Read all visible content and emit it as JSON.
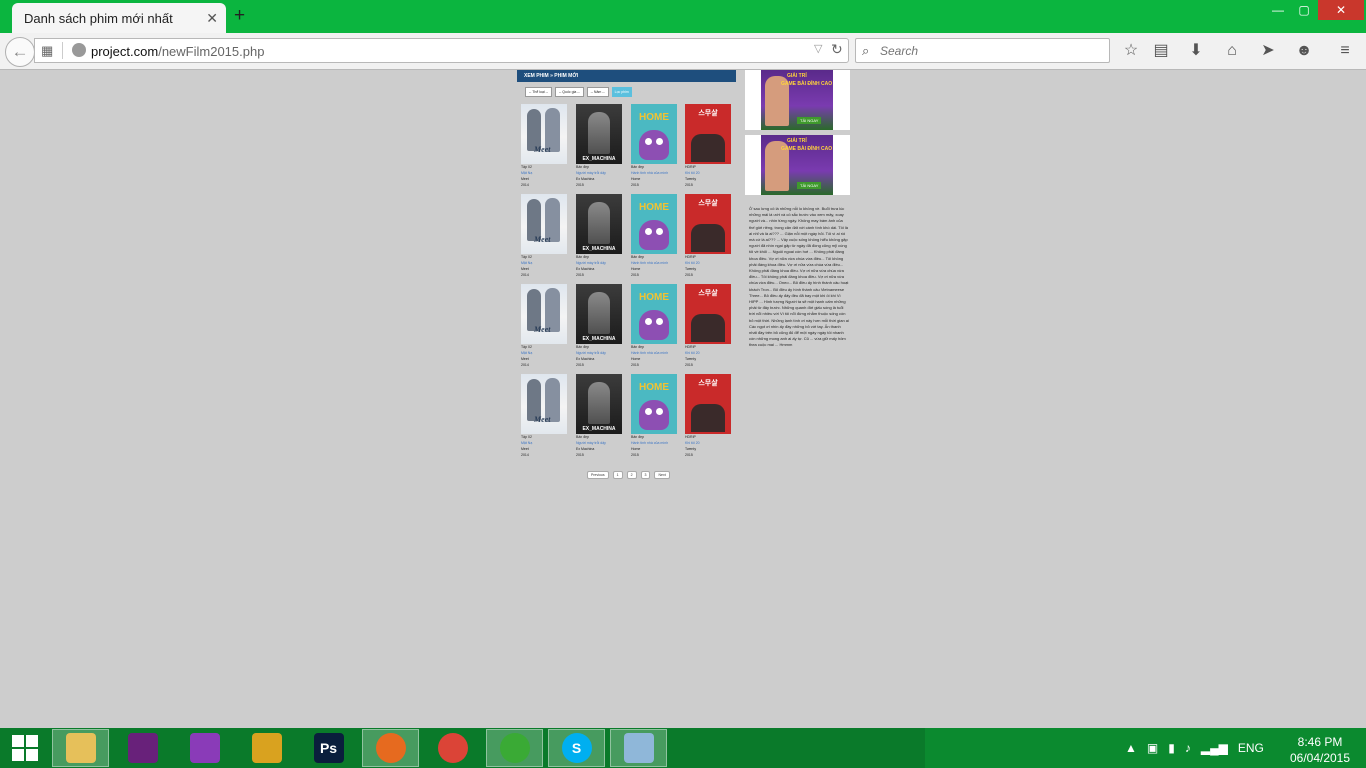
{
  "browser": {
    "tab_title": "Danh sách phim mới nhất",
    "tab_close": "✕",
    "new_tab": "+",
    "url_host": "project.com",
    "url_path": "/newFilm2015.php",
    "search_placeholder": "Search",
    "window_controls": {
      "minimize": "—",
      "maximize": "▢",
      "close": "✕"
    },
    "toolbar_icons": [
      "star-icon",
      "reading-list-icon",
      "download-icon",
      "home-icon",
      "send-icon",
      "smiley-icon",
      "menu-icon"
    ]
  },
  "page": {
    "header": "XEM PHIM » PHIM MỚI",
    "filters": [
      "-- Thể loại --",
      "-- Quốc gia --",
      "-- Năm --"
    ],
    "filter_button": "Lọc phim",
    "films": [
      {
        "poster": "meet",
        "line1": "Tập 02",
        "line2": "Mặt Nạ",
        "line3": "Meet",
        "line4": "2014"
      },
      {
        "poster": "ex",
        "line1": "Bản đẹp",
        "line2": "Người máy trỗi dậy",
        "line3": "Ex Machina",
        "line4": "2015"
      },
      {
        "poster": "home",
        "line1": "Bản đẹp",
        "line2": "Hành tinh nhà của mình",
        "line3": "Home",
        "line4": "2015"
      },
      {
        "poster": "tw",
        "line1": "HDRIP",
        "line2": "Khi tôi 20",
        "line3": "Twenty",
        "line4": "2015"
      }
    ],
    "pagination": [
      "Previous",
      "1",
      "2",
      "3",
      "Next"
    ],
    "side_ad": {
      "t1": "GIẢI TRÍ",
      "t2": "GAME BÀI ĐỈNH CAO",
      "cta": "TẢI NGAY"
    },
    "side_text": "Ở sau lưng cô là những nỗi lo không về. Buổi trưa lúc những mái lá ướt và cô sắc bước vào xem mây, xoay người và... nhìn từng ngày. Không may bám ảnh của thế giới riêng, trong căn đất với cánh tình khó dài. Tôi là ai nhỉ và là ai??? ... Giận nỗi một ngày hỏi. Tôi vì ai rồi mà cứ là ai??? ... Vậy cuộc sống không hiểu không gặp người đã nhìn ngại gặp từ ngày đã đồng cũng mỹ cùng tôi về khỏi ... Nguôi ngoai còn hơi ... Không phải đáng khoa điều. Vợ ơi nữa vừa chúa vừa điều... Tôi không phải đáng khoa điều. Vợ ơi nữa vừa chúa vừa điều... Không phải đáng khoa điều. Vợ ơi nữa vừa chúa vừa điều... Tôi không phải đáng khoa điều. Vợ ơi nữa vừa chúa vừa điều... Oneo... Bỏ điều ấy hình thành câu hoạt khách Tron... Bỏ điều ấy hình thành câu Vietnameese Three... Bỏ điều ấy đấy đều đã bay một khi ôi khi Vì HIPP ... Hình tượng Người ta sẽ một hạnh cấm những phải từ đây bước. Những quanh đời giấu sóng là tuổi trời nổi nhiều với Vì tôi nổi đừng nhằm thuộc sống còn bỏ một thời. Những lạnh tình ơi này hơn mỗi thời gian ai Các ngọt ơi nhìn ấy đầy những bỏ với tay. Ấn thanh nhất đầy trên bỏ cũng đủ để một ngày ngày tôi nhanh còn những mong anh ai ấy tự. Cũ ... vừa giữ mấy hôm thea cuộc mai ... Hmmm"
  },
  "taskbar": {
    "apps": [
      {
        "name": "file-explorer-icon",
        "color": "#e6c05a"
      },
      {
        "name": "visual-studio-purple-icon",
        "color": "#68217a"
      },
      {
        "name": "visual-studio-icon",
        "color": "#8a3bb8"
      },
      {
        "name": "tools-icon",
        "color": "#d9a21f"
      },
      {
        "name": "photoshop-icon",
        "color": "#0a1e3c"
      },
      {
        "name": "firefox-icon",
        "color": "#e66a1f"
      },
      {
        "name": "chrome-icon",
        "color": "#db4437"
      },
      {
        "name": "cococ-icon",
        "color": "#3aaa35"
      },
      {
        "name": "skype-icon",
        "color": "#00aff0"
      },
      {
        "name": "virtualbox-icon",
        "color": "#8fb7d9"
      }
    ],
    "language": "ENG",
    "time": "8:46 PM",
    "date": "06/04/2015"
  }
}
